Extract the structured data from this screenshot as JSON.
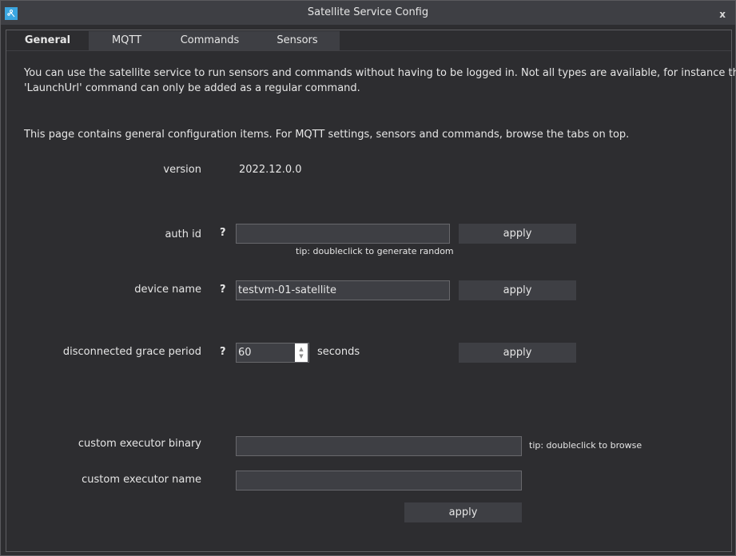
{
  "window": {
    "title": "Satellite Service Config",
    "app_icon": "satellite-icon",
    "close_label": "x"
  },
  "tabs": [
    {
      "label": "General",
      "active": true
    },
    {
      "label": "MQTT",
      "active": false
    },
    {
      "label": "Commands",
      "active": false
    },
    {
      "label": "Sensors",
      "active": false
    }
  ],
  "general": {
    "intro_line1": "You can use the satellite service to run sensors and commands without having to be logged in. Not all types are available, for instance the",
    "intro_line2": "'LaunchUrl' command can only be added as a regular command.",
    "info": "This page contains general configuration items. For MQTT settings, sensors and commands, browse the tabs on top.",
    "version_label": "version",
    "version_value": "2022.12.0.0",
    "help_glyph": "?",
    "auth_id": {
      "label": "auth id",
      "value": "",
      "tip": "tip: doubleclick to generate random",
      "apply_label": "apply"
    },
    "device_name": {
      "label": "device name",
      "value": "testvm-01-satellite",
      "apply_label": "apply"
    },
    "grace_period": {
      "label": "disconnected grace period",
      "value": "60",
      "unit": "seconds",
      "apply_label": "apply"
    },
    "executor_binary": {
      "label": "custom executor binary",
      "value": "",
      "tip": "tip: doubleclick to browse"
    },
    "executor_name": {
      "label": "custom executor name",
      "value": ""
    },
    "executor_apply_label": "apply"
  }
}
